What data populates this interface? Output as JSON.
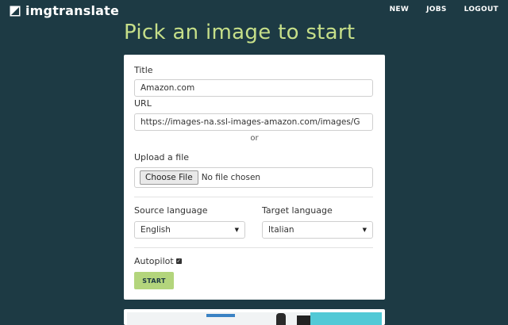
{
  "brand": {
    "name": "imgtranslate",
    "icon": "logo-square-icon"
  },
  "nav": {
    "new": "NEW",
    "jobs": "JOBS",
    "logout": "LOGOUT"
  },
  "page": {
    "title": "Pick an image to start"
  },
  "form": {
    "title_label": "Title",
    "title_value": "Amazon.com",
    "url_label": "URL",
    "url_value": "https://images-na.ssl-images-amazon.com/images/G",
    "or_text": "or",
    "upload_label": "Upload a file",
    "choose_file_label": "Choose File",
    "file_status": "No file chosen",
    "source_language_label": "Source language",
    "source_language_value": "English",
    "target_language_label": "Target language",
    "target_language_value": "Italian",
    "autopilot_label": "Autopilot",
    "autopilot_checked": true,
    "start_label": "START"
  },
  "colors": {
    "background": "#1d3a44",
    "accent": "#c6df89",
    "button": "#b3d57c"
  }
}
